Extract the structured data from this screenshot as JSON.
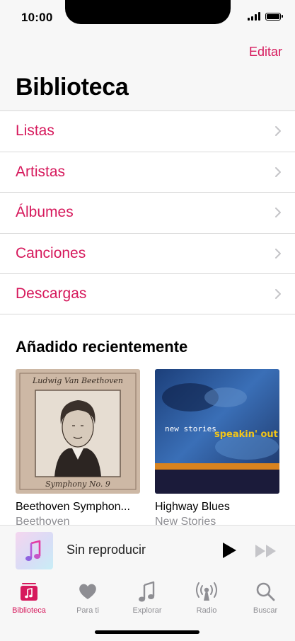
{
  "status_bar": {
    "time": "10:00"
  },
  "header": {
    "edit_label": "Editar",
    "title": "Biblioteca"
  },
  "menu": [
    {
      "label": "Listas"
    },
    {
      "label": "Artistas"
    },
    {
      "label": "Álbumes"
    },
    {
      "label": "Canciones"
    },
    {
      "label": "Descargas"
    }
  ],
  "recent": {
    "title": "Añadido recientemente",
    "albums": [
      {
        "title": "Beethoven Symphon...",
        "artist": "Beethoven",
        "cover_text_top": "Ludwig Van Beethoven",
        "cover_text_bottom": "Symphony No. 9"
      },
      {
        "title": "Highway Blues",
        "artist": "New Stories",
        "cover_text_left": "new stories",
        "cover_text_right": "speakin' out"
      }
    ]
  },
  "mini_player": {
    "label": "Sin reproducir"
  },
  "tabs": [
    {
      "label": "Biblioteca",
      "icon": "library-icon",
      "active": true
    },
    {
      "label": "Para ti",
      "icon": "heart-icon"
    },
    {
      "label": "Explorar",
      "icon": "music-note-icon"
    },
    {
      "label": "Radio",
      "icon": "radio-icon"
    },
    {
      "label": "Buscar",
      "icon": "search-icon"
    }
  ],
  "colors": {
    "accent": "#d6195c",
    "inactive": "#8e8e93",
    "bar_bg": "#f7f7f7"
  }
}
